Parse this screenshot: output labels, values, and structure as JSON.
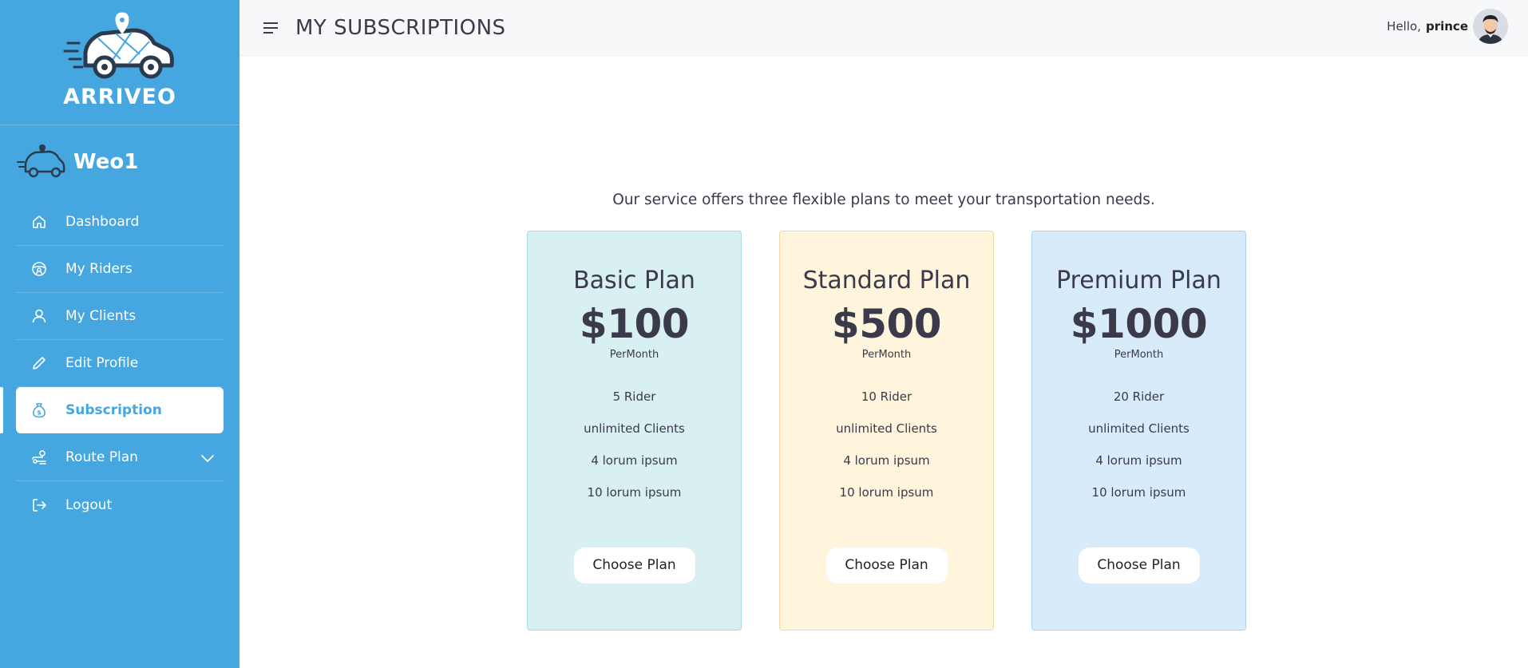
{
  "brand": {
    "name": "ARRIVEO"
  },
  "company": {
    "name": "Weo1"
  },
  "sidebar": {
    "items": [
      {
        "label": "Dashboard",
        "icon": "home-icon"
      },
      {
        "label": "My Riders",
        "icon": "steering-wheel-icon"
      },
      {
        "label": "My Clients",
        "icon": "user-icon"
      },
      {
        "label": "Edit Profile",
        "icon": "pencil-icon"
      },
      {
        "label": "Subscription",
        "icon": "money-bag-icon",
        "active": true
      },
      {
        "label": "Route Plan",
        "icon": "route-icon",
        "expandable": true
      },
      {
        "label": "Logout",
        "icon": "logout-icon"
      }
    ]
  },
  "header": {
    "title": "MY SUBSCRIPTIONS",
    "greeting": "Hello,",
    "username": "prince"
  },
  "main": {
    "intro": "Our service offers three flexible plans to meet your transportation needs.",
    "plans": [
      {
        "name": "Basic Plan",
        "price": "$100",
        "period": "PerMonth",
        "features": [
          "5 Rider",
          "unlimited Clients",
          "4 lorum ipsum",
          "10 lorum ipsum"
        ],
        "button": "Choose Plan",
        "color": "#d8f0f1"
      },
      {
        "name": "Standard Plan",
        "price": "$500",
        "period": "PerMonth",
        "features": [
          "10 Rider",
          "unlimited Clients",
          "4 lorum ipsum",
          "10 lorum ipsum"
        ],
        "button": "Choose Plan",
        "color": "#fff4dc"
      },
      {
        "name": "Premium Plan",
        "price": "$1000",
        "period": "PerMonth",
        "features": [
          "20 Rider",
          "unlimited Clients",
          "4 lorum ipsum",
          "10 lorum ipsum"
        ],
        "button": "Choose Plan",
        "color": "#d7ebfa"
      }
    ]
  },
  "colors": {
    "sidebar": "#45a6e0",
    "text": "#3a3a4a",
    "header_bg": "#f7f8fa"
  }
}
